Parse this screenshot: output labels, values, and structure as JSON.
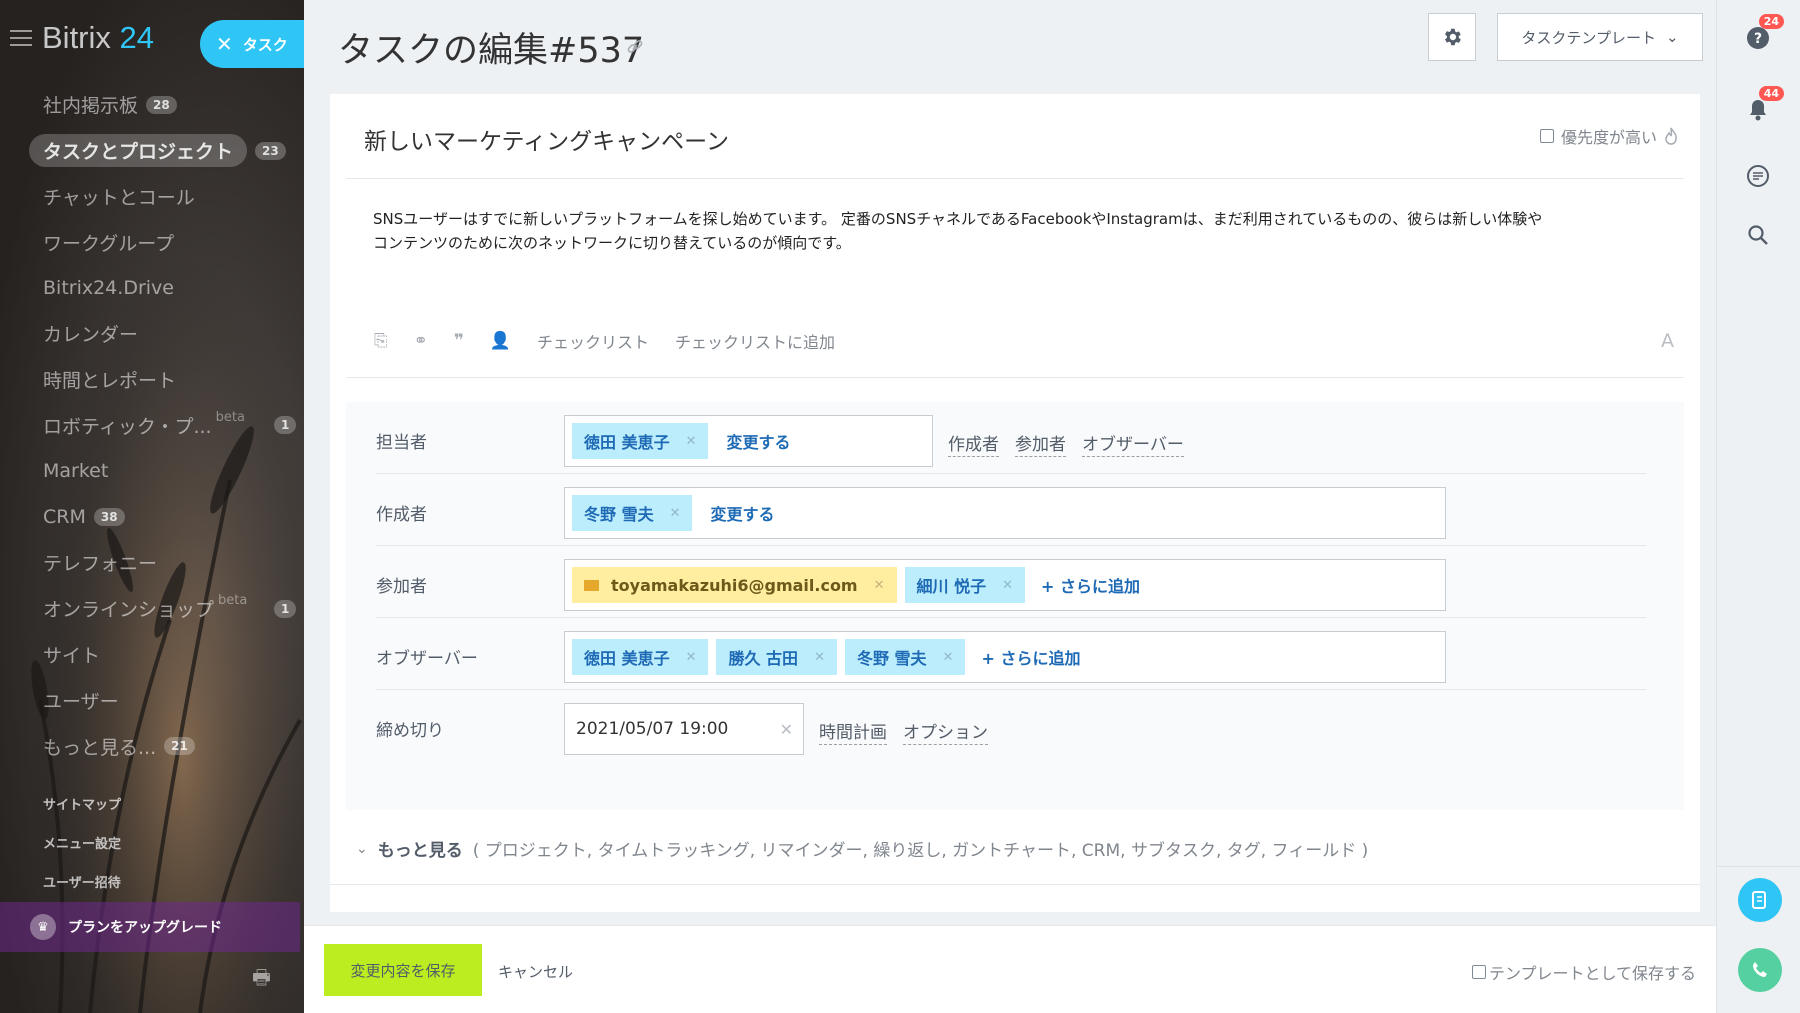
{
  "sidebar": {
    "logo_name": "Bitrix",
    "logo_num": "24",
    "task_button": "タスク",
    "items": [
      {
        "label": "社内掲示板",
        "count": "28"
      },
      {
        "label": "タスクとプロジェクト",
        "count": "23"
      },
      {
        "label": "チャットとコール"
      },
      {
        "label": "ワークグループ"
      },
      {
        "label": "Bitrix24.Drive"
      },
      {
        "label": "カレンダー"
      },
      {
        "label": "時間とレポート"
      },
      {
        "label": "ロボティック・プ...",
        "beta": "beta",
        "count": "1"
      },
      {
        "label": "Market"
      },
      {
        "label": "CRM",
        "count": "38"
      },
      {
        "label": "テレフォニー"
      },
      {
        "label": "オンラインショップ",
        "beta": "beta",
        "count": "1"
      },
      {
        "label": "サイト"
      },
      {
        "label": "ユーザー"
      },
      {
        "label": "もっと見る...",
        "count": "21"
      }
    ],
    "sitemap": "サイトマップ",
    "menu_settings": "メニュー設定",
    "invite_users": "ユーザー招待",
    "upgrade": "プランをアップグレード"
  },
  "header": {
    "title": "タスクの編集#537",
    "template_button": "タスクテンプレート"
  },
  "task": {
    "name": "新しいマーケティングキャンペーン",
    "priority_label": "優先度が高い",
    "description_line1": "SNSユーザーはすでに新しいプラットフォームを探し始めています。 定番のSNSチャネルであるFacebookやInstagramは、まだ利用されているものの、彼らは新しい体験や",
    "description_line2": "コンテンツのために次のネットワークに切り替えているのが傾向です。",
    "toolbar": {
      "checklist": "チェックリスト",
      "add_to_checklist": "チェックリストに追加",
      "font": "A"
    }
  },
  "fields": {
    "assignee": {
      "label": "担当者",
      "person": "徳田 美恵子",
      "change": "変更する",
      "links": [
        "作成者",
        "参加者",
        "オブザーバー"
      ]
    },
    "creator": {
      "label": "作成者",
      "person": "冬野 雪夫",
      "change": "変更する"
    },
    "participants": {
      "label": "参加者",
      "email": "toyamakazuhi6@gmail.com",
      "person": "細川 悦子",
      "add": "さらに追加"
    },
    "observers": {
      "label": "オブザーバー",
      "people": [
        "徳田 美恵子",
        "勝久 古田",
        "冬野 雪夫"
      ],
      "add": "さらに追加"
    },
    "deadline": {
      "label": "締め切り",
      "value": "2021/05/07 19:00",
      "time_plan": "時間計画",
      "options": "オプション"
    }
  },
  "more": {
    "label": "もっと見る",
    "list": "( プロジェクト, タイムトラッキング, リマインダー, 繰り返し, ガントチャート, CRM, サブタスク, タグ, フィールド )"
  },
  "footer": {
    "save": "変更内容を保存",
    "cancel": "キャンセル",
    "save_template": "テンプレートとして保存する"
  },
  "rightbar": {
    "help_badge": "24",
    "notify_badge": "44"
  },
  "colors": {
    "accent": "#2fc6f6",
    "save": "#bbed21",
    "chip": "#bcedfc",
    "mail_chip": "#ffeea0",
    "badge": "#ff5752"
  }
}
